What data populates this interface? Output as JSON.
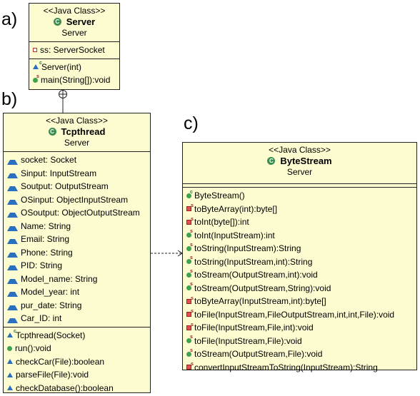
{
  "labels": {
    "a": "a)",
    "b": "b)",
    "c": "c)"
  },
  "server": {
    "stereotype": "<<Java Class>>",
    "name": "Server",
    "package": "Server",
    "attributes": [
      {
        "text": "ss: ServerSocket",
        "icon": "private-field-icon"
      }
    ],
    "methods": [
      {
        "text": "Server(int)",
        "icon": "constructor-icon"
      },
      {
        "text": "main(String[]):void",
        "icon": "public-static-method-icon"
      }
    ]
  },
  "tcpthread": {
    "stereotype": "<<Java Class>>",
    "name": "Tcpthread",
    "package": "Server",
    "attributes": [
      "socket: Socket",
      "Sinput: InputStream",
      "Soutput: OutputStream",
      "OSinput: ObjectInputStream",
      "OSoutput: ObjectOutputStream",
      "Name: String",
      "Email: String",
      "Phone: String",
      "PID: String",
      "Model_name: String",
      "Model_year: int",
      "pur_date: String",
      "Car_ID: int"
    ],
    "methods": [
      {
        "text": "Tcpthread(Socket)",
        "icon": "constructor-icon"
      },
      {
        "text": "run():void",
        "icon": "public-method-icon"
      },
      {
        "text": "checkCar(File):boolean",
        "icon": "package-method-icon"
      },
      {
        "text": "parseFile(File):void",
        "icon": "package-method-icon"
      },
      {
        "text": "checkDatabase():boolean",
        "icon": "package-method-icon"
      }
    ]
  },
  "bytestream": {
    "stereotype": "<<Java Class>>",
    "name": "ByteStream",
    "package": "Server",
    "methods": [
      {
        "text": "ByteStream()",
        "icon": "constructor-icon"
      },
      {
        "text": "toByteArray(int):byte[]",
        "icon": "private-static-method-icon"
      },
      {
        "text": "toInt(byte[]):int",
        "icon": "private-static-method-icon"
      },
      {
        "text": "toInt(InputStream):int",
        "icon": "public-static-method-icon"
      },
      {
        "text": "toString(InputStream):String",
        "icon": "public-static-method-icon"
      },
      {
        "text": "toString(InputStream,int):String",
        "icon": "public-static-method-icon"
      },
      {
        "text": "toStream(OutputStream,int):void",
        "icon": "public-static-method-icon"
      },
      {
        "text": "toStream(OutputStream,String):void",
        "icon": "public-static-method-icon"
      },
      {
        "text": "toByteArray(InputStream,int):byte[]",
        "icon": "private-static-method-icon"
      },
      {
        "text": "toFile(InputStream,FileOutputStream,int,int,File):void",
        "icon": "private-static-method-icon"
      },
      {
        "text": "toFile(InputStream,File,int):void",
        "icon": "private-static-method-icon"
      },
      {
        "text": "toFile(InputStream,File):void",
        "icon": "public-static-method-icon"
      },
      {
        "text": "toStream(OutputStream,File):void",
        "icon": "public-static-method-icon"
      },
      {
        "text": "convertInputStreamToString(InputStream):String",
        "icon": "private-static-method-icon"
      }
    ]
  },
  "colors": {
    "class_fill": "#fdfbd0",
    "border": "#222222",
    "class_icon": "#3b8e4f"
  }
}
